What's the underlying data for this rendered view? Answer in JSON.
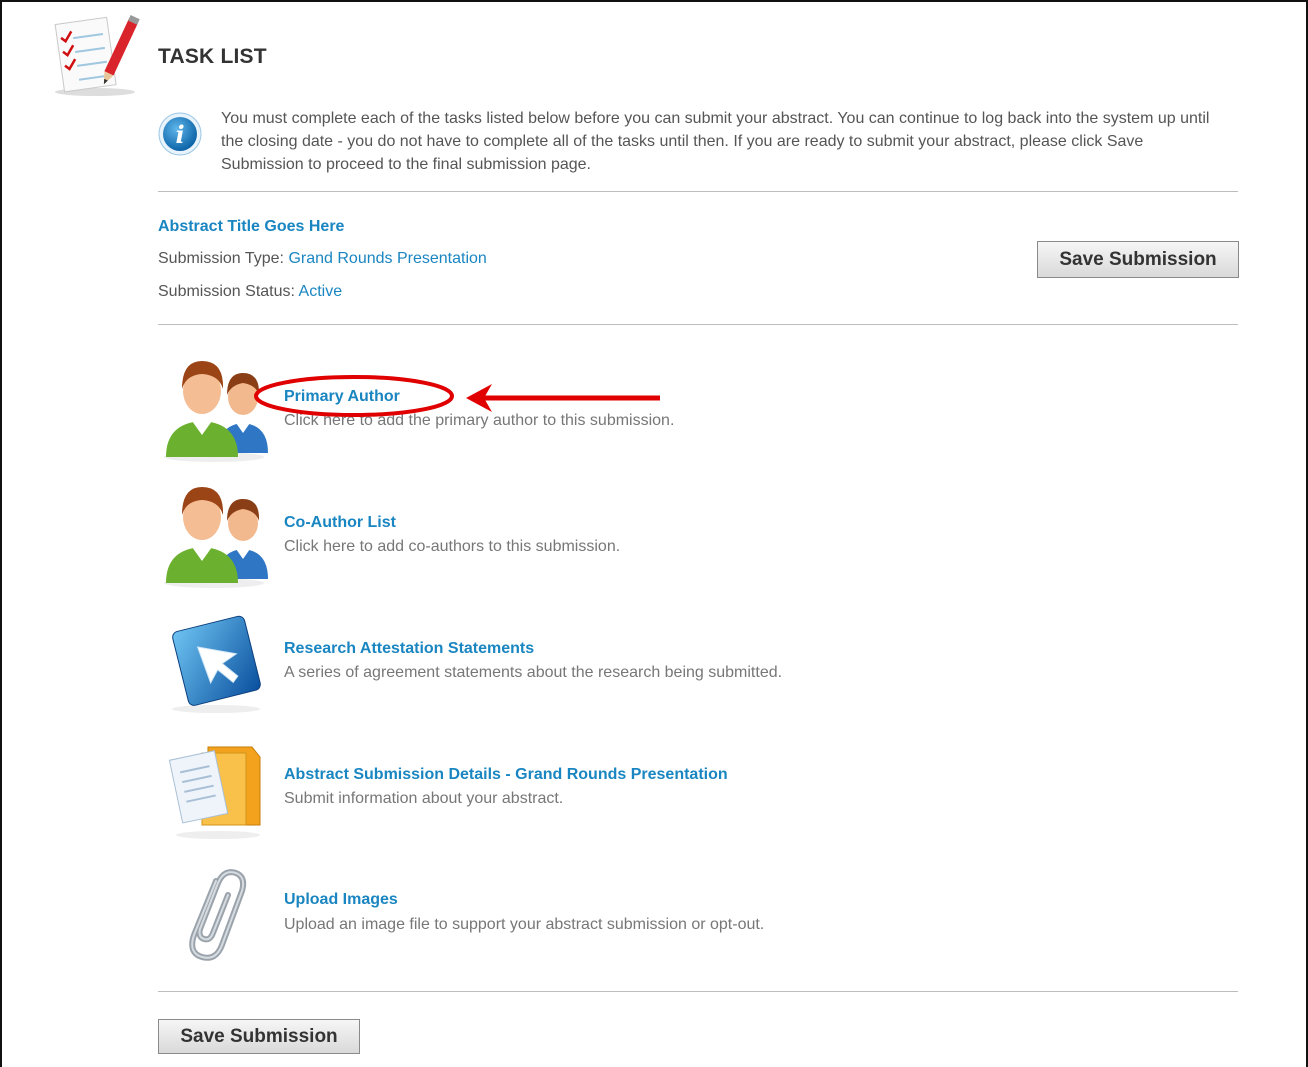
{
  "header": {
    "title": "TASK LIST",
    "logo_icon": "checklist-pencil-icon"
  },
  "info": {
    "icon": "info-icon",
    "text": "You must complete each of the tasks listed below before you can submit your abstract. You can continue to log back into the system up until the closing date - you do not have to complete all of the tasks until then. If you are ready to submit your abstract, please click Save Submission to proceed to the final submission page."
  },
  "submission": {
    "title": "Abstract Title Goes Here",
    "type_label": "Submission Type:",
    "type_value": "Grand Rounds Presentation",
    "status_label": "Submission Status:",
    "status_value": "Active",
    "save_label": "Save Submission"
  },
  "tasks": [
    {
      "name": "Primary Author",
      "desc": "Click here to add the primary author to this submission.",
      "icon": "users-icon"
    },
    {
      "name": "Co-Author List",
      "desc": "Click here to add co-authors to this submission.",
      "icon": "users-icon"
    },
    {
      "name": "Research Attestation Statements",
      "desc": "A series of agreement statements about the research being submitted.",
      "icon": "cursor-arrow-icon"
    },
    {
      "name": "Abstract Submission Details - Grand Rounds Presentation",
      "desc": "Submit information about your abstract.",
      "icon": "documents-folder-icon"
    },
    {
      "name": "Upload Images",
      "desc": "Upload an image file to support your abstract submission or opt-out.",
      "icon": "paperclip-icon"
    }
  ],
  "footer": {
    "save_label": "Save Submission"
  },
  "colors": {
    "link": "#1a86c1",
    "annotation": "#e00000"
  }
}
